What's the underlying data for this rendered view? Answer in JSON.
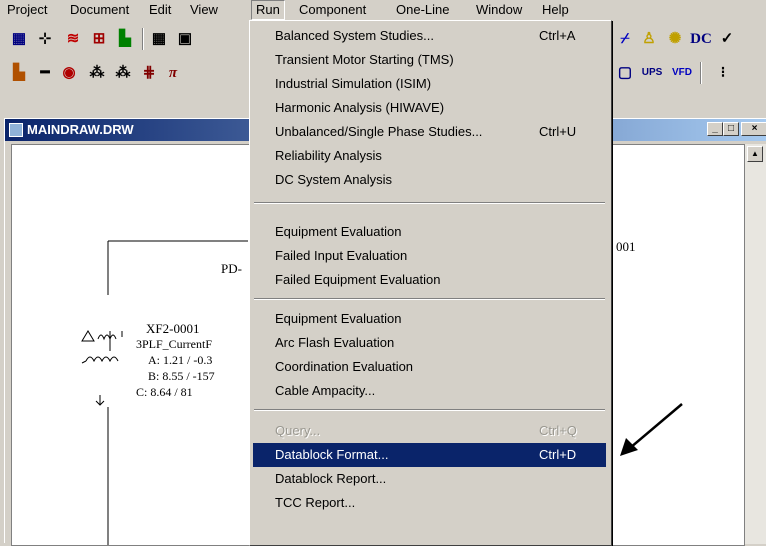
{
  "menubar": {
    "items": [
      "Project",
      "Document",
      "Edit",
      "View",
      "Run",
      "Component",
      "One-Line",
      "Window",
      "Help"
    ]
  },
  "toolbar2": {
    "dc_label": "DC",
    "ups_label": "UPS",
    "vfd_label": "VFD",
    "pi_label": "π"
  },
  "window": {
    "title": "MAINDRAW.DRW"
  },
  "diagram": {
    "pd_label": "PD-",
    "id_fragment": "001",
    "xf_name": "XF2-0001",
    "datablock_title": "3PLF_CurrentF",
    "phase_a": "A: 1.21 / -0.3",
    "phase_b": "B: 8.55 / -157",
    "phase_c": "C: 8.64 / 81"
  },
  "run_menu": {
    "groups": [
      [
        {
          "label": "Balanced System Studies...",
          "shortcut": "Ctrl+A"
        },
        {
          "label": "Transient Motor Starting (TMS)",
          "shortcut": ""
        },
        {
          "label": "Industrial Simulation (ISIM)",
          "shortcut": ""
        },
        {
          "label": "Harmonic Analysis (HIWAVE)",
          "shortcut": ""
        },
        {
          "label": "Unbalanced/Single Phase Studies...",
          "shortcut": "Ctrl+U"
        },
        {
          "label": "Reliability Analysis",
          "shortcut": ""
        },
        {
          "label": "DC System Analysis",
          "shortcut": ""
        }
      ],
      [
        {
          "label": "Equipment Evaluation",
          "shortcut": ""
        },
        {
          "label": "Failed Input Evaluation",
          "shortcut": ""
        },
        {
          "label": "Failed Equipment Evaluation",
          "shortcut": ""
        }
      ],
      [
        {
          "label": "Equipment Evaluation",
          "shortcut": ""
        },
        {
          "label": "Arc Flash Evaluation",
          "shortcut": ""
        },
        {
          "label": "Coordination Evaluation",
          "shortcut": ""
        },
        {
          "label": "Cable Ampacity...",
          "shortcut": ""
        }
      ],
      [
        {
          "label": "Query...",
          "shortcut": "Ctrl+Q",
          "disabled": true
        },
        {
          "label": "Datablock Format...",
          "shortcut": "Ctrl+D",
          "selected": true
        },
        {
          "label": "Datablock Report...",
          "shortcut": ""
        },
        {
          "label": "TCC Report...",
          "shortcut": ""
        }
      ]
    ]
  },
  "colors": {
    "highlight": "#0a246a",
    "titlebar": "#0a246a",
    "face": "#d4d0c8"
  }
}
